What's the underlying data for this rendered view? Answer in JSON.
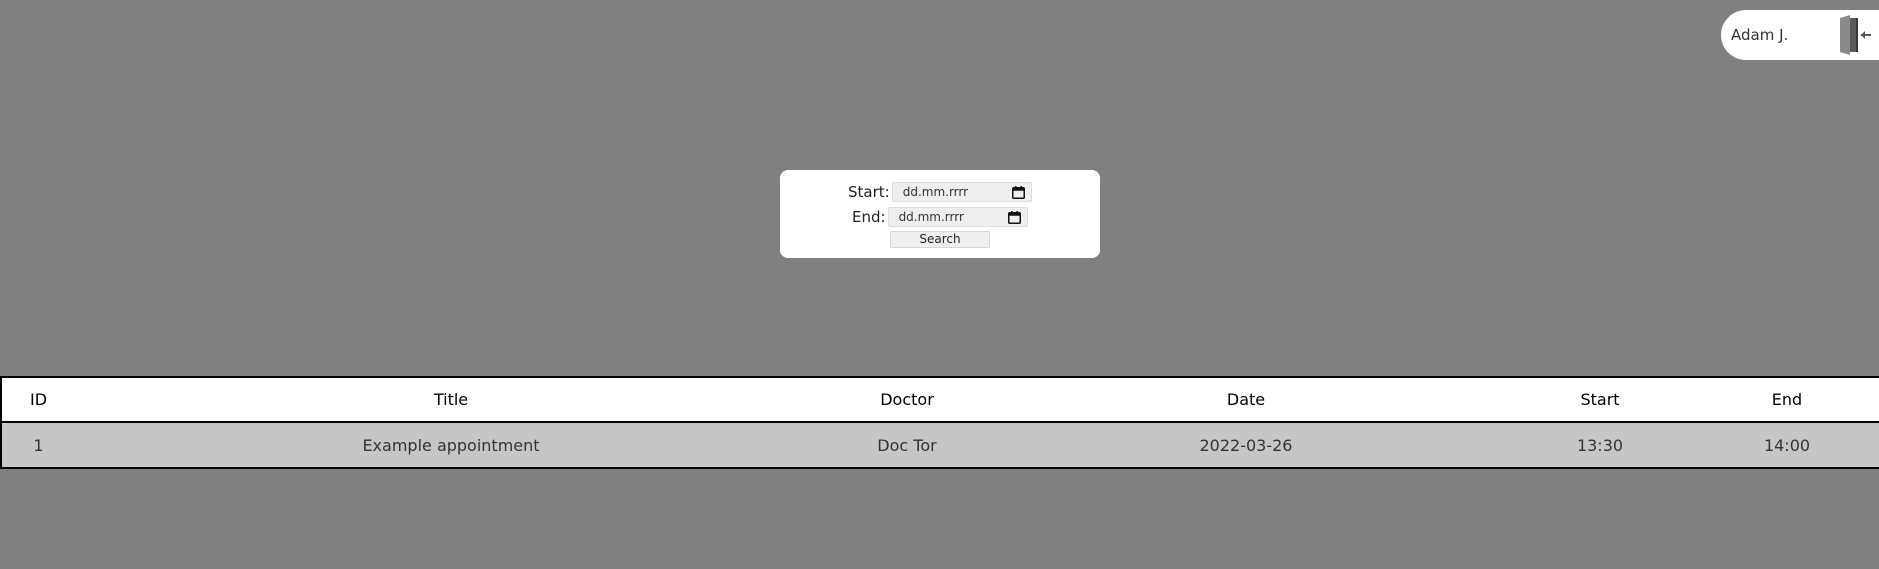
{
  "user": {
    "name": "Adam J.",
    "logout_icon": "door-exit-icon"
  },
  "search": {
    "start_label": "Start:",
    "start_placeholder": "dd.mm.rrrr",
    "end_label": "End:",
    "end_placeholder": "dd.mm.rrrr",
    "calendar_icon": "calendar-icon",
    "button_label": "Search"
  },
  "table": {
    "headers": [
      "ID",
      "Title",
      "Doctor",
      "Date",
      "Start",
      "End"
    ],
    "rows": [
      [
        "1",
        "Example appointment",
        "Doc Tor",
        "2022-03-26",
        "13:30",
        "14:00"
      ]
    ]
  }
}
